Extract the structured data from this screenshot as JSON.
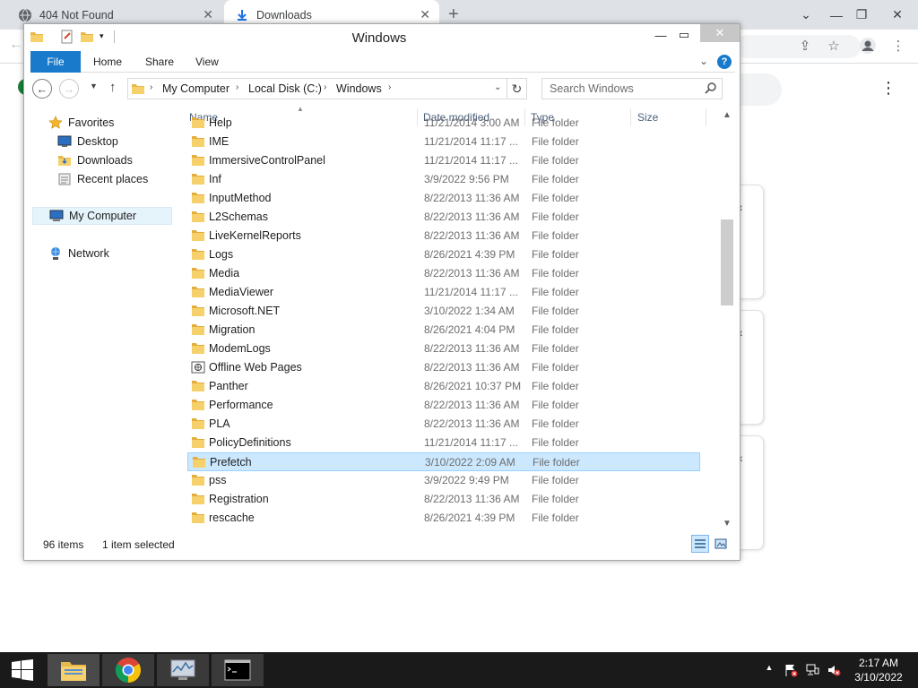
{
  "browser": {
    "tabs": [
      {
        "label": "404 Not Found"
      },
      {
        "label": "Downloads"
      }
    ],
    "new_tab": "+"
  },
  "explorer": {
    "title": "Windows",
    "ribbon_tabs": [
      "File",
      "Home",
      "Share",
      "View"
    ],
    "breadcrumb": [
      "My Computer",
      "Local Disk (C:)",
      "Windows"
    ],
    "search_placeholder": "Search Windows",
    "nav": {
      "favorites": "Favorites",
      "desktop": "Desktop",
      "downloads": "Downloads",
      "recent": "Recent places",
      "mycomputer": "My Computer",
      "network": "Network"
    },
    "columns": {
      "name": "Name",
      "date": "Date modified",
      "type": "Type",
      "size": "Size"
    },
    "files": [
      {
        "name": "Help",
        "date": "11/21/2014 3:00 AM",
        "type": "File folder"
      },
      {
        "name": "IME",
        "date": "11/21/2014 11:17 ...",
        "type": "File folder"
      },
      {
        "name": "ImmersiveControlPanel",
        "date": "11/21/2014 11:17 ...",
        "type": "File folder"
      },
      {
        "name": "Inf",
        "date": "3/9/2022 9:56 PM",
        "type": "File folder"
      },
      {
        "name": "InputMethod",
        "date": "8/22/2013 11:36 AM",
        "type": "File folder"
      },
      {
        "name": "L2Schemas",
        "date": "8/22/2013 11:36 AM",
        "type": "File folder"
      },
      {
        "name": "LiveKernelReports",
        "date": "8/22/2013 11:36 AM",
        "type": "File folder"
      },
      {
        "name": "Logs",
        "date": "8/26/2021 4:39 PM",
        "type": "File folder"
      },
      {
        "name": "Media",
        "date": "8/22/2013 11:36 AM",
        "type": "File folder"
      },
      {
        "name": "MediaViewer",
        "date": "11/21/2014 11:17 ...",
        "type": "File folder"
      },
      {
        "name": "Microsoft.NET",
        "date": "3/10/2022 1:34 AM",
        "type": "File folder"
      },
      {
        "name": "Migration",
        "date": "8/26/2021 4:04 PM",
        "type": "File folder"
      },
      {
        "name": "ModemLogs",
        "date": "8/22/2013 11:36 AM",
        "type": "File folder"
      },
      {
        "name": "Offline Web Pages",
        "date": "8/22/2013 11:36 AM",
        "type": "File folder"
      },
      {
        "name": "Panther",
        "date": "8/26/2021 10:37 PM",
        "type": "File folder"
      },
      {
        "name": "Performance",
        "date": "8/22/2013 11:36 AM",
        "type": "File folder"
      },
      {
        "name": "PLA",
        "date": "8/22/2013 11:36 AM",
        "type": "File folder"
      },
      {
        "name": "PolicyDefinitions",
        "date": "11/21/2014 11:17 ...",
        "type": "File folder"
      },
      {
        "name": "Prefetch",
        "date": "3/10/2022 2:09 AM",
        "type": "File folder"
      },
      {
        "name": "pss",
        "date": "3/9/2022 9:49 PM",
        "type": "File folder"
      },
      {
        "name": "Registration",
        "date": "8/22/2013 11:36 AM",
        "type": "File folder"
      },
      {
        "name": "rescache",
        "date": "8/26/2021 4:39 PM",
        "type": "File folder"
      }
    ],
    "status": {
      "count": "96 items",
      "selected": "1 item selected"
    }
  },
  "taskbar": {
    "time": "2:17 AM",
    "date": "3/10/2022"
  },
  "colors": {
    "accent": "#1979ca",
    "selection": "#cce8ff",
    "taskbar": "#1a1a1a",
    "folder": "#f0c850"
  }
}
